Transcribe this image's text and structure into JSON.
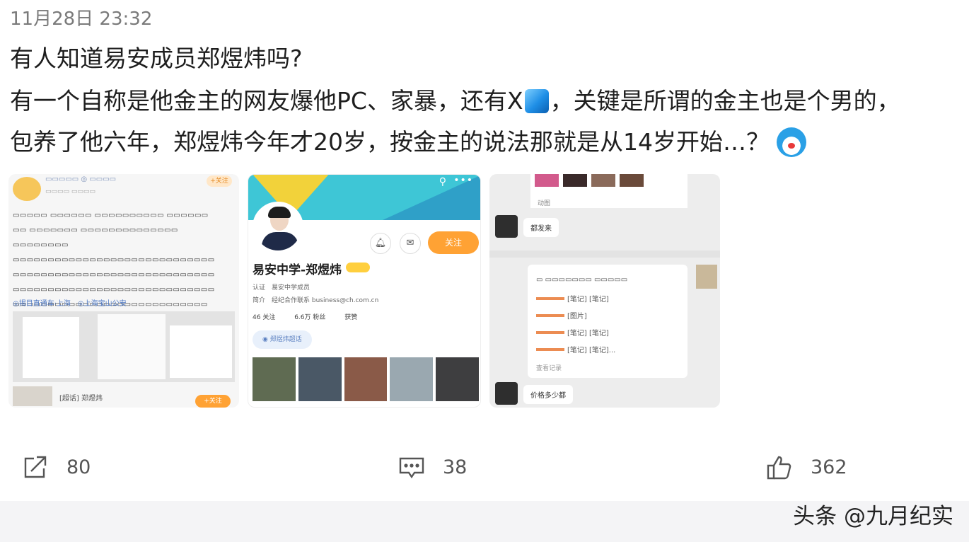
{
  "post": {
    "timestamp": "11月28日 23:32",
    "title": "有人知道易安成员郑煜炜吗?",
    "body_line1_a": "有一个自称是他金主的网友爆他PC、家暴，还有X",
    "body_line1_b": "，关键是所谓的金主也是个男的，",
    "body_line2": "包养了他六年，郑煜炜今年才20岁，按金主的说法那就是从14岁开始…？",
    "emoji_icons": [
      "blue-cube-icon",
      "doraemon-shocked-icon"
    ]
  },
  "images": [
    {
      "kind": "weibo-post-screenshot",
      "follow_label": "+关注",
      "links": "◎揭目直通车·上海　◎上海宝山公安",
      "bottom_label": "[超话] 郑煜炜",
      "bottom_button": "+关注"
    },
    {
      "kind": "weibo-profile-screenshot",
      "name": "易安中学-郑煜炜",
      "follow_label": "关注",
      "meta_cert": "认证　易安中学成员",
      "meta_intro": "简介　经纪合作联系 business@ch.com.cn",
      "stats": [
        "46 关注",
        "6.6万 粉丝",
        "获赞"
      ],
      "tag": "◉ 郑煜炜超话"
    },
    {
      "kind": "chat-screenshot",
      "top_label": "动图",
      "bubble_1": "都发来",
      "card_rows": [
        "[笔记] [笔记]",
        "[图片]",
        "[笔记] [笔记]",
        "[笔记] [笔记]..."
      ],
      "card_foot": "查看记录",
      "bubble_2": "价格多少都"
    }
  ],
  "actions": {
    "share": {
      "icon": "share-icon",
      "count": "80"
    },
    "comment": {
      "icon": "comment-icon",
      "count": "38"
    },
    "like": {
      "icon": "thumbs-up-icon",
      "count": "362"
    }
  },
  "watermark": "头条 @九月纪实",
  "colors": {
    "accent_orange": "#ffa234",
    "link_blue": "#4d78c4",
    "text_gray": "#555555"
  }
}
